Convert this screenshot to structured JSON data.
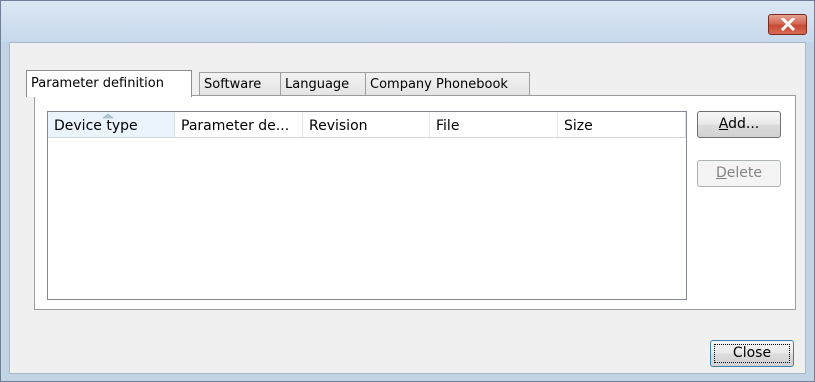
{
  "window": {
    "title": ""
  },
  "tabs": [
    {
      "label": "Parameter definition",
      "active": true
    },
    {
      "label": "Software",
      "active": false
    },
    {
      "label": "Language",
      "active": false
    },
    {
      "label": "Company Phonebook",
      "active": false
    }
  ],
  "list": {
    "columns": [
      "Device type",
      "Parameter de...",
      "Revision",
      "File",
      "Size"
    ],
    "sorted_column": "Device type",
    "rows": []
  },
  "buttons": {
    "add": {
      "mnemonic": "A",
      "rest": "dd..."
    },
    "delete": {
      "mnemonic": "D",
      "rest": "elete"
    },
    "close": "Close"
  },
  "colors": {
    "close_button": "#c74a35",
    "sort_highlight": "#eaf4fc",
    "default_button_border": "#3c7fb1"
  }
}
